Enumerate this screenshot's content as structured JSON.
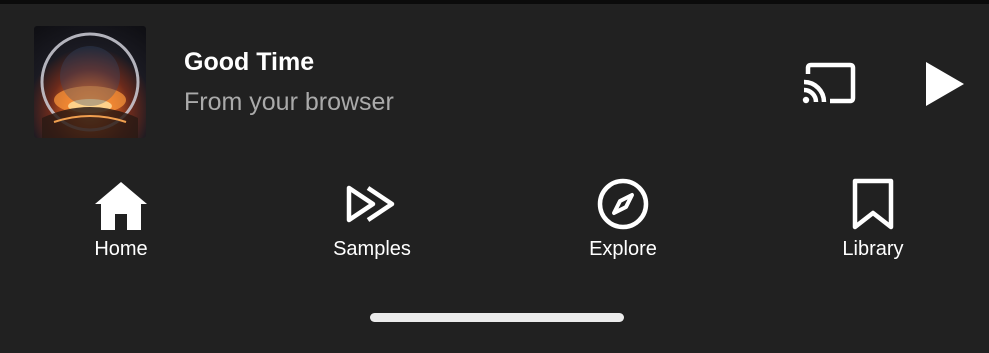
{
  "now_playing": {
    "title": "Good Time",
    "subtitle": "From your browser",
    "album_art_icon": "album-art-thumbnail",
    "cast_icon": "cast-icon",
    "play_icon": "play-icon"
  },
  "bottom_nav": {
    "items": [
      {
        "label": "Home",
        "icon": "home-icon"
      },
      {
        "label": "Samples",
        "icon": "samples-icon"
      },
      {
        "label": "Explore",
        "icon": "compass-icon"
      },
      {
        "label": "Library",
        "icon": "bookmark-icon"
      }
    ]
  },
  "colors": {
    "background": "#212121",
    "text_primary": "#ffffff",
    "text_secondary": "#aaaaaa"
  }
}
